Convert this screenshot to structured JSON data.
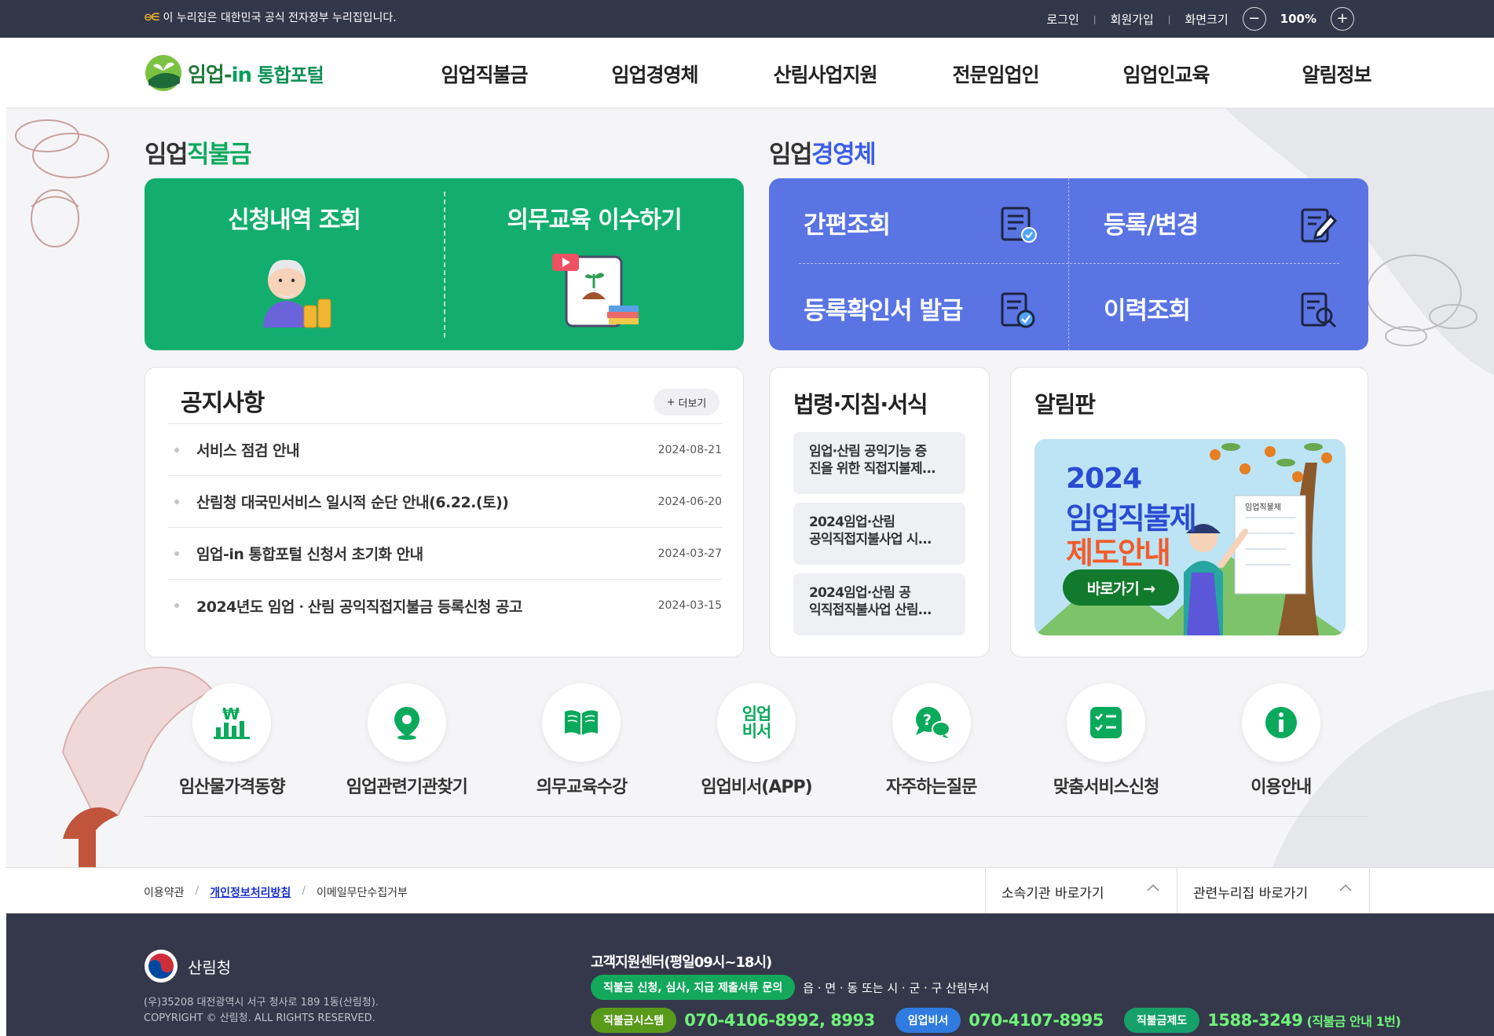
{
  "colors": {
    "topbar": "#33374a",
    "green_accent": "#13ae6e",
    "blue_accent": "#5a74e4",
    "footer": "#34384a"
  },
  "topbar": {
    "gov_notice": "이 누리집은 대한민국 공식 전자정부 누리집입니다.",
    "login": "로그인",
    "signup": "회원가입",
    "screen_size": "화면크기",
    "zoom_minus": "−",
    "zoom_value": "100%",
    "zoom_plus": "+"
  },
  "header": {
    "logo_main": "임업-",
    "logo_in": "in",
    "logo_sub": " 통합포털",
    "gnb": [
      "임업직불금",
      "임업경영체",
      "산림사업지원",
      "전문임업인",
      "임업인교육",
      "알림정보"
    ]
  },
  "direct_payment": {
    "title_a": "임업",
    "title_b": "직불금",
    "items": [
      "신청내역 조회",
      "의무교육 이수하기"
    ]
  },
  "management": {
    "title_a": "임업",
    "title_b": "경영체",
    "items": [
      "간편조회",
      "등록/변경",
      "등록확인서 발급",
      "이력조회"
    ]
  },
  "notice": {
    "title": "공지사항",
    "more": "더보기",
    "rows": [
      {
        "text": "서비스 점검 안내",
        "date": "2024-08-21"
      },
      {
        "text": "산림청 대국민서비스 일시적 순단 안내(6.22.(토))",
        "date": "2024-06-20"
      },
      {
        "text": "임업-in 통합포털 신청서 초기화 안내",
        "date": "2024-03-27"
      },
      {
        "text": "2024년도 임업ㆍ산림 공익직접지불금 등록신청 공고",
        "date": "2024-03-15"
      }
    ]
  },
  "law": {
    "title": "법령·지침·서식",
    "items": [
      [
        "임업·산림 공익기능 증",
        "진을 위한 직접지불제..."
      ],
      [
        "2024임업·산림",
        "공익직접지불사업 시..."
      ],
      [
        "2024임업·산림 공",
        "익직접직불사업 산림..."
      ]
    ]
  },
  "board": {
    "title": "알림판",
    "banner_year": "2024",
    "banner_line1": "임업직불제",
    "banner_line2": "제도안내",
    "banner_go": "바로가기 →",
    "banner_doc": "임업직불제"
  },
  "quick_menu": [
    {
      "label": "임산물가격동향",
      "icon": "price-chart-icon"
    },
    {
      "label": "임업관련기관찾기",
      "icon": "location-pin-icon"
    },
    {
      "label": "의무교육수강",
      "icon": "book-icon"
    },
    {
      "label": "임업비서(APP)",
      "icon": "app-text-icon",
      "icon_text_1": "임업",
      "icon_text_2": "비서"
    },
    {
      "label": "자주하는질문",
      "icon": "faq-bubble-icon"
    },
    {
      "label": "맞춤서비스신청",
      "icon": "checklist-icon"
    },
    {
      "label": "이용안내",
      "icon": "info-icon"
    }
  ],
  "footer_links": {
    "terms": "이용약관",
    "privacy": "개인정보처리방침",
    "email": "이메일무단수집거부",
    "sel1": "소속기관 바로가기",
    "sel2": "관련누리집 바로가기"
  },
  "footer": {
    "org": "산림청",
    "address": "(우)35208 대전광역시 서구 청사로 189 1동(산림청).",
    "copyright": "COPYRIGHT © 산림청. ALL RIGHTS RESERVED.",
    "cs_title": "고객지원센터(평일09시~18시)",
    "cs_pill": "직불금 신청, 심사, 지급 제출서류 문의",
    "cs_desc": "읍 · 면 · 동 또는 시 · 군 · 구 산림부서",
    "sys1_label": "직불금시스템",
    "sys1_tel": "070-4106-8992, 8993",
    "sys2_label": "임업비서",
    "sys2_tel": "070-4107-8995",
    "sys3_label": "직불금제도",
    "sys3_tel": "1588-3249",
    "sys3_note": " (직불금 안내 1번)"
  }
}
